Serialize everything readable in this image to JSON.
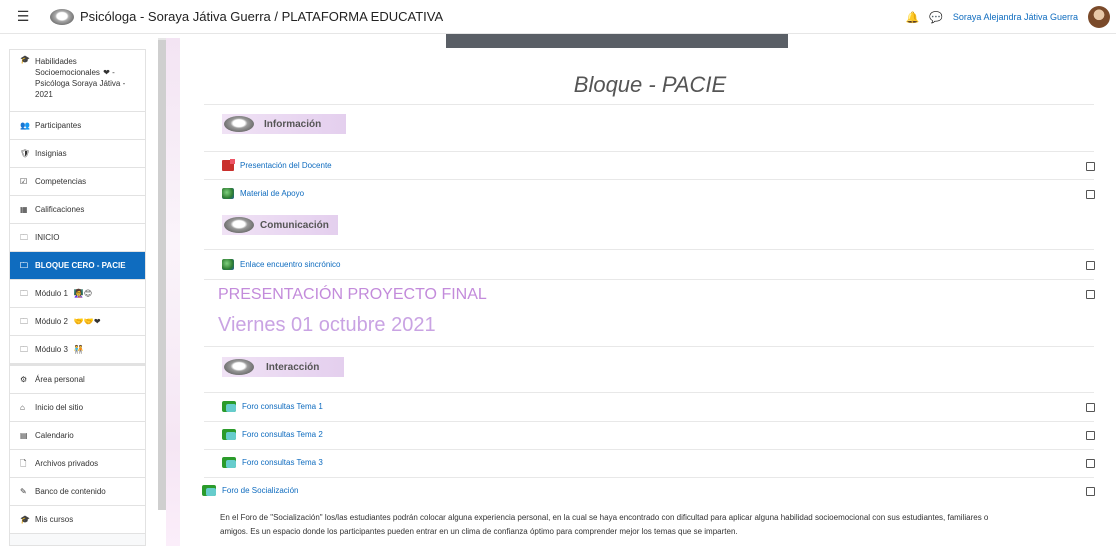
{
  "navbar": {
    "menu_icon": "hamburger-icon",
    "site_title": "Psicóloga - Soraya Játiva Guerra / PLATAFORMA EDUCATIVA",
    "notification_icon": "bell-icon",
    "message_icon": "chat-bubble-icon",
    "user_name": "Soraya Alejandra Játiva Guerra"
  },
  "sidebar": {
    "course": {
      "label": "Habilidades Socioemocionales",
      "rest": "- Psicóloga Soraya Játiva - 2021"
    },
    "items": [
      {
        "label": "Participantes",
        "icon": "users-icon"
      },
      {
        "label": "Insignias",
        "icon": "badge-icon"
      },
      {
        "label": "Competencias",
        "icon": "checkbox-icon"
      },
      {
        "label": "Calificaciones",
        "icon": "table-icon"
      },
      {
        "label": "INICIO",
        "icon": "folder-icon"
      },
      {
        "label": "BLOQUE CERO - PACIE",
        "icon": "folder-icon"
      },
      {
        "label": "Módulo 1",
        "icon": "folder-icon"
      },
      {
        "label": "Módulo 2",
        "icon": "folder-icon"
      },
      {
        "label": "Módulo 3",
        "icon": "folder-icon"
      }
    ],
    "bottom_items": [
      {
        "label": "Área personal",
        "icon": "dashboard-icon"
      },
      {
        "label": "Inicio del sitio",
        "icon": "home-icon"
      },
      {
        "label": "Calendario",
        "icon": "calendar-icon"
      },
      {
        "label": "Archivos privados",
        "icon": "file-icon"
      },
      {
        "label": "Banco de contenido",
        "icon": "pen-icon"
      },
      {
        "label": "Mis cursos",
        "icon": "graduation-cap-icon"
      }
    ],
    "accent_color": "#0f6cbf"
  },
  "main": {
    "section_title": "Bloque - PACIE",
    "labels": {
      "informacion": "Información",
      "comunicacion": "Comunicación",
      "interaccion": "Interacción"
    },
    "activities": {
      "presentacion": "Presentación del Docente",
      "material": "Material de Apoyo",
      "enlace": "Enlace encuentro sincrónico",
      "foro1": "Foro consultas Tema 1",
      "foro2": "Foro consultas Tema 2",
      "foro3": "Foro consultas Tema 3",
      "socializacion": "Foro de Socialización"
    },
    "proyecto_title": "PRESENTACIÓN PROYECTO FINAL",
    "proyecto_date": "Viernes 01 octubre 2021",
    "description_1": "En el Foro de \"Socialización\" los/las estudiantes podrán colocar alguna experiencia personal, en la cual se haya encontrado con dificultad para aplicar alguna habilidad socioemocional con sus estudiantes, familiares o",
    "description_2": "amigos.  Es un espacio donde los participantes pueden entrar en un clima de confianza óptimo para comprender mejor los temas que se imparten."
  }
}
